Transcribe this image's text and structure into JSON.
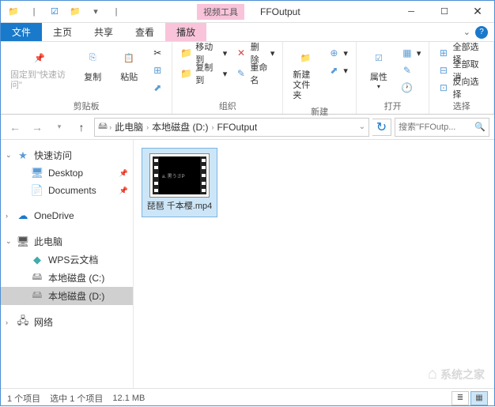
{
  "titlebar": {
    "tool_tab": "视频工具",
    "title": "FFOutput"
  },
  "ribbon_tabs": {
    "file": "文件",
    "home": "主页",
    "share": "共享",
    "view": "查看",
    "play": "播放"
  },
  "ribbon": {
    "clipboard": {
      "pin": "固定到\"快速访问\"",
      "copy": "复制",
      "paste": "粘贴",
      "label": "剪贴板"
    },
    "organize": {
      "moveto": "移动到",
      "delete": "删除",
      "copyto": "复制到",
      "rename": "重命名",
      "label": "组织"
    },
    "new": {
      "newfolder": "新建\n文件夹",
      "label": "新建"
    },
    "open": {
      "properties": "属性",
      "label": "打开"
    },
    "select": {
      "all": "全部选择",
      "none": "全部取消",
      "invert": "反向选择",
      "label": "选择"
    }
  },
  "breadcrumb": {
    "seg1": "此电脑",
    "seg2": "本地磁盘 (D:)",
    "seg3": "FFOutput"
  },
  "search": {
    "placeholder": "搜索\"FFOutp..."
  },
  "sidebar": {
    "quick": "快速访问",
    "desktop": "Desktop",
    "documents": "Documents",
    "onedrive": "OneDrive",
    "thispc": "此电脑",
    "wps": "WPS云文档",
    "driveC": "本地磁盘 (C:)",
    "driveD": "本地磁盘 (D:)",
    "network": "网络"
  },
  "file": {
    "name": "琵琶 千本樱.mp4",
    "thumb_text": "a. 黒うさP"
  },
  "status": {
    "count": "1 个项目",
    "selected": "选中 1 个项目",
    "size": "12.1 MB"
  },
  "watermark": "系统之家"
}
